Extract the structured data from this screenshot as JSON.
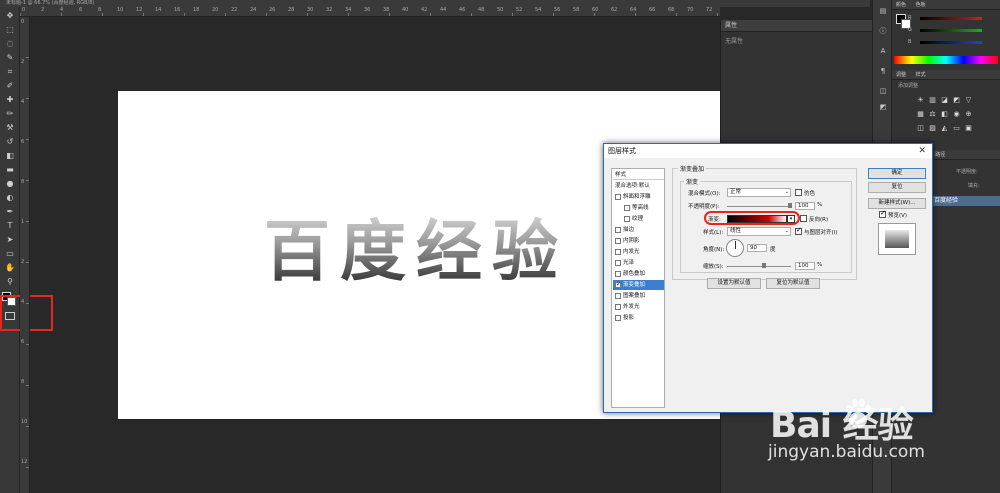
{
  "document": {
    "tab_title": "未标题-1 @ 66.7% (百度经验, RGB/8)",
    "canvas_text": "百度经验"
  },
  "rulers": {
    "top_ticks": [
      "0",
      "2",
      "4",
      "6",
      "8",
      "10",
      "12",
      "14",
      "16",
      "18",
      "20",
      "22",
      "24",
      "26",
      "28",
      "30",
      "32",
      "34",
      "36",
      "38",
      "40",
      "42",
      "44",
      "46",
      "48",
      "50",
      "52",
      "54",
      "56",
      "58",
      "60",
      "62",
      "64",
      "66",
      "68",
      "70",
      "72"
    ],
    "left_ticks": [
      "0",
      "2",
      "4",
      "6",
      "8",
      "1",
      "2",
      "4",
      "6",
      "8",
      "10",
      "12"
    ]
  },
  "toolbox": {
    "tools": [
      "move-tool",
      "marquee-tool",
      "lasso-tool",
      "quick-select-tool",
      "crop-tool",
      "eyedropper-tool",
      "healing-tool",
      "brush-tool",
      "stamp-tool",
      "history-brush-tool",
      "eraser-tool",
      "gradient-tool",
      "blur-tool",
      "dodge-tool",
      "pen-tool",
      "type-tool",
      "path-select-tool",
      "shape-tool",
      "hand-tool",
      "zoom-tool"
    ],
    "tool_glyphs": [
      "✥",
      "⬚",
      "◌",
      "✎",
      "⌗",
      "✐",
      "✚",
      "✏",
      "⚒",
      "↺",
      "◧",
      "▬",
      "●",
      "◐",
      "✒",
      "T",
      "➤",
      "▭",
      "✋",
      "⚲"
    ]
  },
  "properties_panel": {
    "title": "属性",
    "empty_text": "无属性"
  },
  "color_panel": {
    "tabs": [
      "颜色",
      "色板"
    ],
    "channels": [
      {
        "label": "R",
        "color": "#cc2222"
      },
      {
        "label": "G",
        "color": "#22aa22"
      },
      {
        "label": "B",
        "color": "#2244cc"
      }
    ]
  },
  "adjustments_panel": {
    "tabs": [
      "调整",
      "样式"
    ],
    "subtitle": "添加调整"
  },
  "layers_panel": {
    "tabs": [
      "图层",
      "通道",
      "路径"
    ],
    "opacity_label": "不透明度:",
    "fill_label": "填充:",
    "layer_name": "百度经验"
  },
  "dialog": {
    "title": "图层样式",
    "close_glyph": "✕",
    "styles_header": "样式",
    "styles": [
      {
        "label": "混合选项:默认",
        "checkbox": false,
        "checked": false,
        "indent": false,
        "selected": false
      },
      {
        "label": "斜面和浮雕",
        "checkbox": true,
        "checked": false,
        "indent": false,
        "selected": false
      },
      {
        "label": "等高线",
        "checkbox": true,
        "checked": false,
        "indent": true,
        "selected": false
      },
      {
        "label": "纹理",
        "checkbox": true,
        "checked": false,
        "indent": true,
        "selected": false
      },
      {
        "label": "描边",
        "checkbox": true,
        "checked": false,
        "indent": false,
        "selected": false
      },
      {
        "label": "内阴影",
        "checkbox": true,
        "checked": false,
        "indent": false,
        "selected": false
      },
      {
        "label": "内发光",
        "checkbox": true,
        "checked": false,
        "indent": false,
        "selected": false
      },
      {
        "label": "光泽",
        "checkbox": true,
        "checked": false,
        "indent": false,
        "selected": false
      },
      {
        "label": "颜色叠加",
        "checkbox": true,
        "checked": false,
        "indent": false,
        "selected": false
      },
      {
        "label": "渐变叠加",
        "checkbox": true,
        "checked": true,
        "indent": false,
        "selected": true
      },
      {
        "label": "图案叠加",
        "checkbox": true,
        "checked": false,
        "indent": false,
        "selected": false
      },
      {
        "label": "外发光",
        "checkbox": true,
        "checked": false,
        "indent": false,
        "selected": false
      },
      {
        "label": "投影",
        "checkbox": true,
        "checked": false,
        "indent": false,
        "selected": false
      }
    ],
    "section_title": "渐变叠加",
    "subsection_title": "渐变",
    "blend_mode_label": "混合模式(O):",
    "blend_mode_value": "正常",
    "dither_label": "仿色",
    "opacity_label": "不透明度(P):",
    "opacity_value": "100",
    "opacity_unit": "%",
    "gradient_label": "渐变:",
    "reverse_label": "反向(R)",
    "style_label": "样式(L):",
    "style_value": "线性",
    "align_label": "与图层对齐(I)",
    "angle_label": "角度(N):",
    "angle_value": "90",
    "angle_unit": "度",
    "scale_label": "缩放(S):",
    "scale_value": "100",
    "scale_unit": "%",
    "make_default": "设置为默认值",
    "reset_default": "复位为默认值",
    "ok": "确定",
    "reset": "复位",
    "new_style": "新建样式(W)...",
    "preview_label": "预览(V)"
  },
  "watermark": {
    "logo": "Bai  经验",
    "url": "jingyan.baidu.com"
  },
  "colors": {
    "accent_red": "#e8261b",
    "selection_blue": "#3d7fcf",
    "app_bg": "#282828"
  }
}
